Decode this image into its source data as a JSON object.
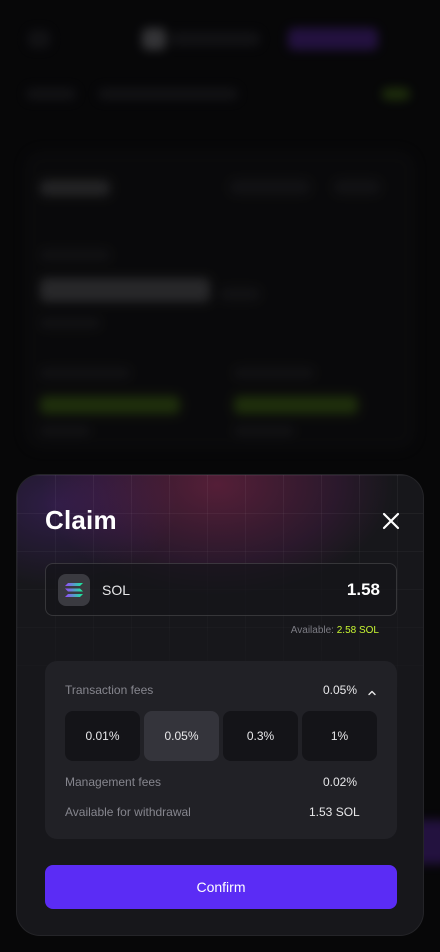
{
  "modal": {
    "title": "Claim",
    "token": {
      "icon": "solana-icon",
      "symbol": "SOL",
      "amount": "1.58"
    },
    "available": {
      "label": "Available:",
      "value": "2.58 SOL"
    },
    "fees": {
      "transaction_label": "Transaction fees",
      "transaction_value": "0.05%",
      "options": [
        "0.01%",
        "0.05%",
        "0.3%",
        "1%"
      ],
      "selected_index": 1,
      "management_label": "Management fees",
      "management_value": "0.02%",
      "withdrawal_label": "Available for withdrawal",
      "withdrawal_value": "1.53 SOL"
    },
    "confirm_label": "Confirm"
  },
  "colors": {
    "accent": "#5b2cf5",
    "available_value": "#c6f432",
    "modal_bg": "#17171b",
    "panel_bg": "#212126"
  }
}
